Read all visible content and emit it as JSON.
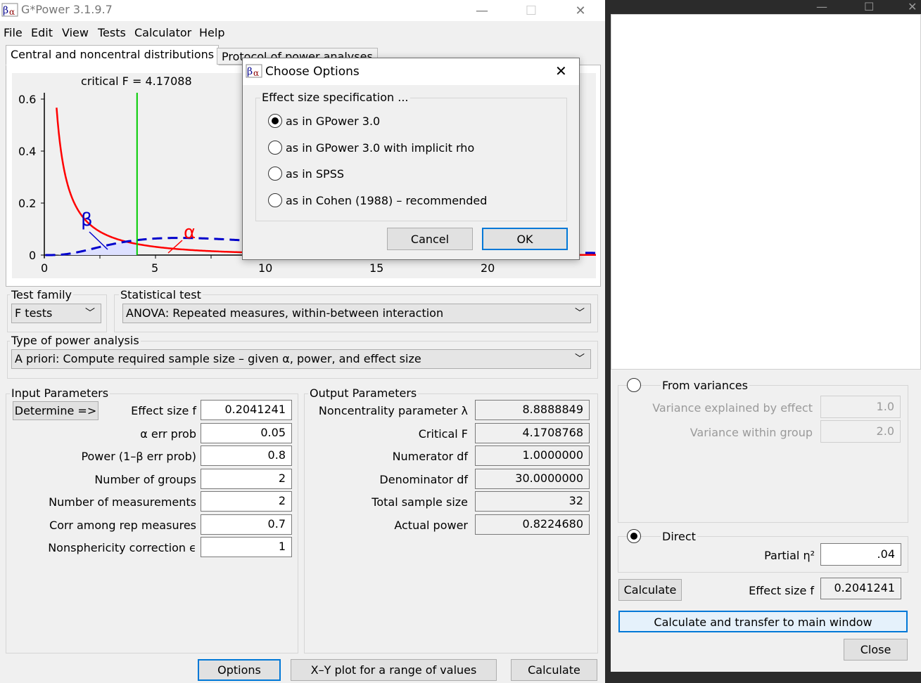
{
  "window": {
    "title": "G*Power 3.1.9.7",
    "minimize": "—",
    "maximize": "☐",
    "close": "✕"
  },
  "menu": [
    "File",
    "Edit",
    "View",
    "Tests",
    "Calculator",
    "Help"
  ],
  "tabs": {
    "distributions": "Central and noncentral distributions",
    "protocol": "Protocol of power analyses"
  },
  "plot": {
    "critical_label": "critical F = 4.17088",
    "beta_symbol": "β",
    "alpha_symbol": "α",
    "yticks": [
      "0.6",
      "0.4",
      "0.2",
      "0"
    ],
    "xticks": [
      "0",
      "5",
      "10",
      "15",
      "20"
    ],
    "critical_f": 4.17088,
    "colors": {
      "central": "#ff0000",
      "noncentral": "#0000cc",
      "critical": "#00cc00",
      "fill": "#dde0ff"
    }
  },
  "test_family": {
    "label": "Test family",
    "value": "F tests"
  },
  "statistical_test": {
    "label": "Statistical test",
    "value": "ANOVA: Repeated measures, within-between interaction"
  },
  "power_type": {
    "label": "Type of power analysis",
    "value": "A priori: Compute required sample size – given α, power, and effect size"
  },
  "input": {
    "label": "Input Parameters",
    "determine": "Determine =>",
    "rows": [
      {
        "label": "Effect size f",
        "value": "0.2041241"
      },
      {
        "label": "α err prob",
        "value": "0.05"
      },
      {
        "label": "Power (1–β err prob)",
        "value": "0.8"
      },
      {
        "label": "Number of groups",
        "value": "2"
      },
      {
        "label": "Number of measurements",
        "value": "2"
      },
      {
        "label": "Corr among rep measures",
        "value": "0.7"
      },
      {
        "label": "Nonsphericity correction ϵ",
        "value": "1"
      }
    ]
  },
  "output": {
    "label": "Output Parameters",
    "rows": [
      {
        "label": "Noncentrality parameter λ",
        "value": "8.8888849"
      },
      {
        "label": "Critical F",
        "value": "4.1708768"
      },
      {
        "label": "Numerator df",
        "value": "1.0000000"
      },
      {
        "label": "Denominator df",
        "value": "30.0000000"
      },
      {
        "label": "Total sample size",
        "value": "32"
      },
      {
        "label": "Actual power",
        "value": "0.8224680"
      }
    ]
  },
  "buttons": {
    "options": "Options",
    "xy_plot": "X–Y plot for a range of values",
    "calculate": "Calculate"
  },
  "dialog": {
    "title": "Choose Options",
    "close": "✕",
    "group_label": "Effect size specification ...",
    "options": [
      {
        "label": "as in GPower 3.0",
        "selected": true
      },
      {
        "label": "as in GPower 3.0 with implicit rho",
        "selected": false
      },
      {
        "label": "as in SPSS",
        "selected": false
      },
      {
        "label": "as in Cohen (1988) – recommended",
        "selected": false
      }
    ],
    "cancel": "Cancel",
    "ok": "OK"
  },
  "calculator": {
    "minimize": "—",
    "maximize": "☐",
    "close": "✕",
    "from_variances": {
      "label": "From variances",
      "explained_label": "Variance explained by effect",
      "explained_value": "1.0",
      "within_label": "Variance within group",
      "within_value": "2.0"
    },
    "direct": {
      "label": "Direct",
      "eta_label": "Partial η²",
      "eta_value": ".04"
    },
    "calculate": "Calculate",
    "effect_label": "Effect size f",
    "effect_value": "0.2041241",
    "transfer": "Calculate and transfer to main window",
    "close_btn": "Close"
  }
}
